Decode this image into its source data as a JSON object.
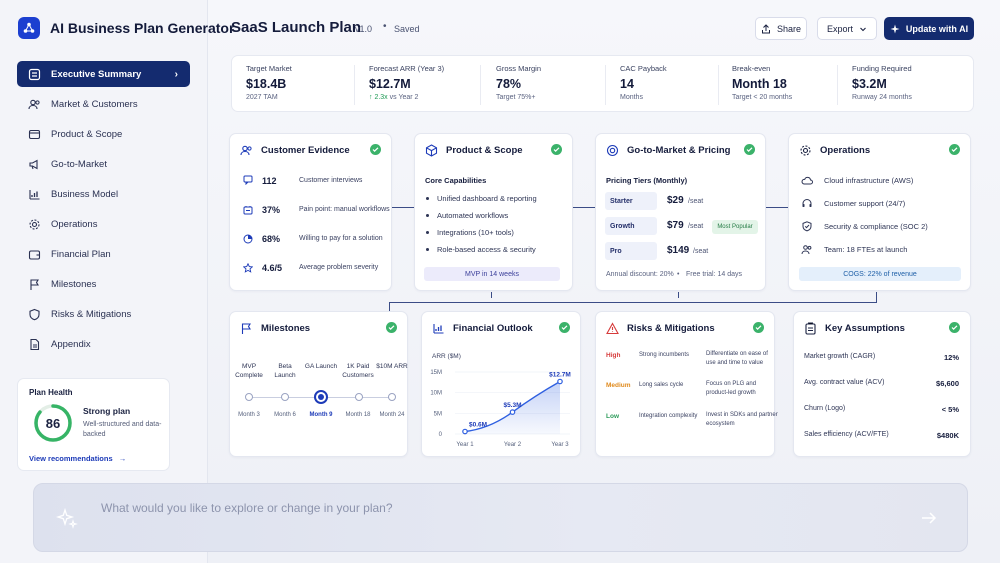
{
  "app": {
    "title": "AI Business Plan Generator"
  },
  "nav": [
    {
      "label": "Executive Summary",
      "icon": "summary-icon",
      "active": true
    },
    {
      "label": "Market & Customers",
      "icon": "users-icon"
    },
    {
      "label": "Product & Scope",
      "icon": "box-icon"
    },
    {
      "label": "Go-to-Market",
      "icon": "megaphone-icon"
    },
    {
      "label": "Business Model",
      "icon": "chart-icon"
    },
    {
      "label": "Operations",
      "icon": "gear-icon"
    },
    {
      "label": "Financial Plan",
      "icon": "wallet-icon"
    },
    {
      "label": "Milestones",
      "icon": "milestone-icon"
    },
    {
      "label": "Risks & Mitigations",
      "icon": "shield-icon"
    },
    {
      "label": "Appendix",
      "icon": "document-icon"
    }
  ],
  "health": {
    "title": "Plan Health",
    "score": "86",
    "score_fraction": 0.86,
    "status": "Strong plan",
    "description": "Well-structured and data-backed",
    "link": "View recommendations"
  },
  "header": {
    "title": "SaaS Launch Plan",
    "version": "v1.0",
    "separator": "•",
    "status": "Saved",
    "share": "Share",
    "export": "Export",
    "update": "Update with AI"
  },
  "kpis": [
    {
      "label": "Target Market",
      "value": "$18.4B",
      "sub": "2027 TAM"
    },
    {
      "label": "Forecast ARR (Year 3)",
      "value": "$12.7M",
      "sub_up": "↑ 2.3x",
      "sub": "vs Year 2"
    },
    {
      "label": "Gross Margin",
      "value": "78%",
      "sub": "Target 75%+"
    },
    {
      "label": "CAC Payback",
      "value": "14",
      "sub": "Months"
    },
    {
      "label": "Break-even",
      "value": "Month 18",
      "sub": "Target < 20 months"
    },
    {
      "label": "Funding Required",
      "value": "$3.2M",
      "sub": "Runway 24 months"
    }
  ],
  "evidence": {
    "title": "Customer Evidence",
    "rows": [
      {
        "value": "112",
        "label": "Customer interviews",
        "icon": "chat-icon"
      },
      {
        "value": "37%",
        "label": "Pain point: manual workflows",
        "icon": "pain-icon"
      },
      {
        "value": "68%",
        "label": "Willing to pay for a solution",
        "icon": "pie-icon"
      },
      {
        "value": "4.6/5",
        "label": "Average problem severity",
        "icon": "star-icon"
      }
    ]
  },
  "product": {
    "title": "Product & Scope",
    "subtitle": "Core Capabilities",
    "items": [
      "Unified dashboard & reporting",
      "Automated workflows",
      "Integrations (10+ tools)",
      "Role-based access & security"
    ],
    "badge": "MVP in 14 weeks"
  },
  "gtm": {
    "title": "Go-to-Market & Pricing",
    "subtitle": "Pricing Tiers (Monthly)",
    "tiers": [
      {
        "name": "Starter",
        "price": "$29",
        "unit": "/seat"
      },
      {
        "name": "Growth",
        "price": "$79",
        "unit": "/seat",
        "tag": "Most Popular"
      },
      {
        "name": "Pro",
        "price": "$149",
        "unit": "/seat"
      }
    ],
    "footer_a": "Annual discount: 20%",
    "footer_sep": "•",
    "footer_b": "Free trial: 14 days"
  },
  "operations": {
    "title": "Operations",
    "rows": [
      {
        "label": "Cloud infrastructure (AWS)",
        "icon": "cloud-icon"
      },
      {
        "label": "Customer support (24/7)",
        "icon": "headset-icon"
      },
      {
        "label": "Security & compliance (SOC 2)",
        "icon": "shield-check-icon"
      },
      {
        "label": "Team: 18 FTEs at launch",
        "icon": "team-icon"
      }
    ],
    "badge": "COGS: 22% of revenue"
  },
  "milestones": {
    "title": "Milestones",
    "items": [
      {
        "label": "MVP Complete",
        "date": "Month 3"
      },
      {
        "label": "Beta Launch",
        "date": "Month 6"
      },
      {
        "label": "GA Launch",
        "date": "Month 9",
        "current": true
      },
      {
        "label": "1K Paid Customers",
        "date": "Month 18"
      },
      {
        "label": "$10M ARR",
        "date": "Month 24"
      }
    ]
  },
  "financial": {
    "title": "Financial Outlook"
  },
  "chart_data": {
    "type": "area",
    "ylabel": "ARR ($M)",
    "categories": [
      "Year 1",
      "Year 2",
      "Year 3"
    ],
    "values": [
      0.6,
      5.3,
      12.7
    ],
    "data_labels": [
      "$0.6M",
      "$5.3M",
      "$12.7M"
    ],
    "yticks": [
      "0",
      "5M",
      "10M",
      "15M"
    ],
    "ylim": [
      0,
      15
    ],
    "color": "#2e5fe0"
  },
  "risks": {
    "title": "Risks & Mitigations",
    "rows": [
      {
        "level": "High",
        "color": "#d63b3b",
        "risk": "Strong incumbents",
        "mitigation": "Differentiate on ease of use and time to value"
      },
      {
        "level": "Medium",
        "color": "#e08a1c",
        "risk": "Long sales cycle",
        "mitigation": "Focus on PLG and product-led growth"
      },
      {
        "level": "Low",
        "color": "#2a9a58",
        "risk": "Integration complexity",
        "mitigation": "Invest in SDKs and partner ecosystem"
      }
    ]
  },
  "assumptions": {
    "title": "Key Assumptions",
    "rows": [
      {
        "label": "Market growth (CAGR)",
        "value": "12%"
      },
      {
        "label": "Avg. contract value (ACV)",
        "value": "$6,600"
      },
      {
        "label": "Churn (Logo)",
        "value": "< 5%"
      },
      {
        "label": "Sales efficiency (ACV/FTE)",
        "value": "$480K"
      }
    ]
  },
  "prompt": {
    "placeholder": "What would you like to explore or change in your plan?"
  }
}
